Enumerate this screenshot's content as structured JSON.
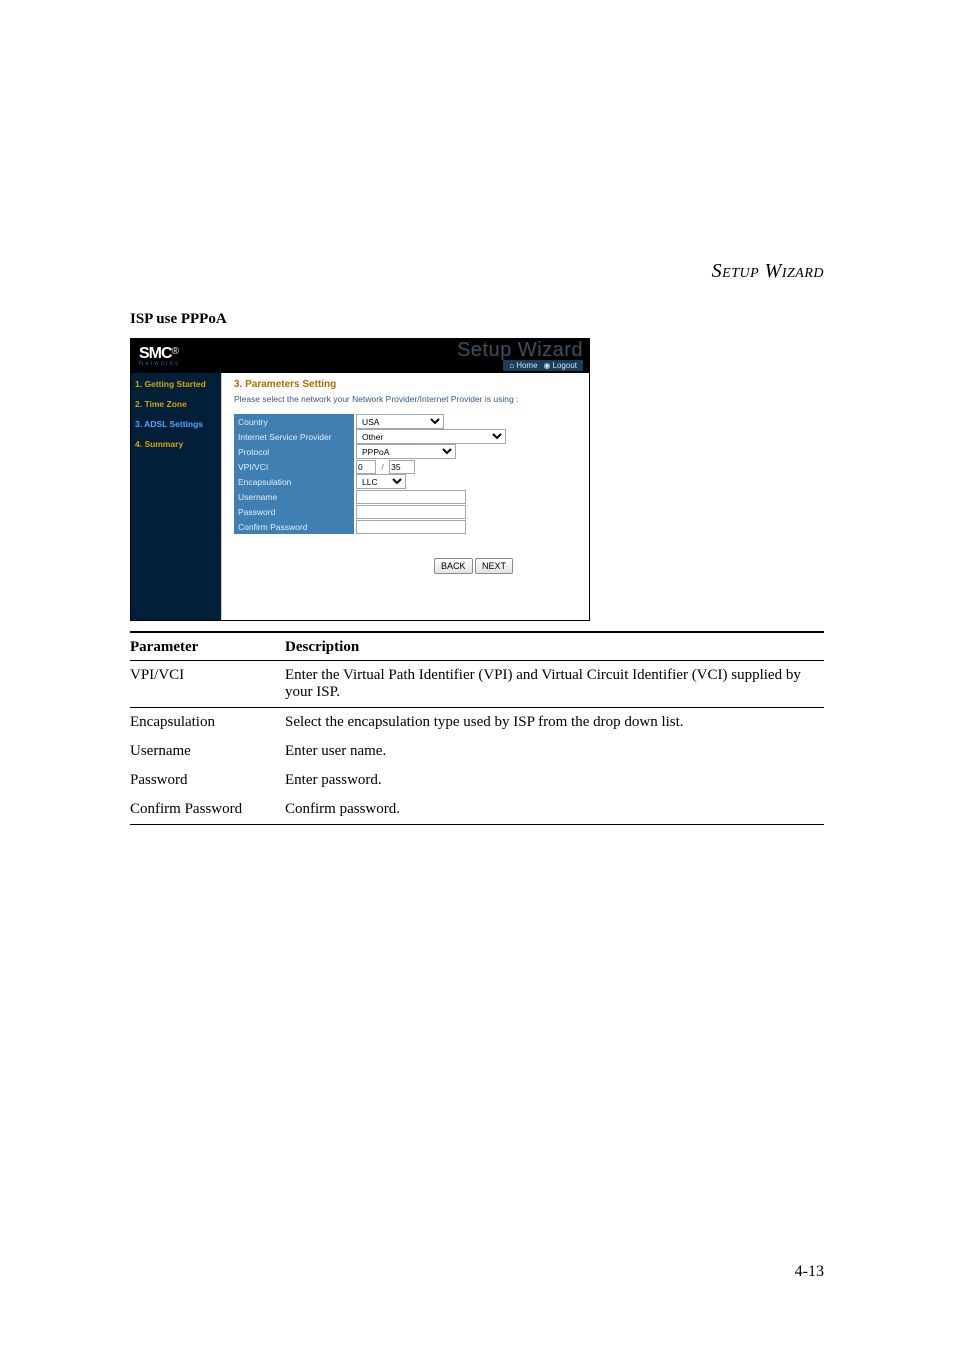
{
  "doc": {
    "running_head": "Setup Wizard",
    "section_title": "ISP use PPPoA",
    "page_number": "4-13"
  },
  "shot": {
    "brand": "SMC",
    "brand_sub": "Networks",
    "watermark": "Setup Wizard",
    "home_label": "Home",
    "logout_label": "Logout",
    "sidebar": {
      "s1": "1. Getting Started",
      "s2": "2. Time Zone",
      "s3": "3. ADSL Settings",
      "s4": "4. Summary"
    },
    "heading": "3. Parameters Setting",
    "instruction": "Please select the network your Network Provider/Internet Provider is using :",
    "rows": {
      "country": {
        "label": "Country",
        "value": "USA"
      },
      "isp": {
        "label": "Internet Service Provider",
        "value": "Other"
      },
      "protocol": {
        "label": "Protocol",
        "value": "PPPoA"
      },
      "vpivci": {
        "label": "VPI/VCI",
        "vpi": "0",
        "vci": "35"
      },
      "encap": {
        "label": "Encapsulation",
        "value": "LLC"
      },
      "user": {
        "label": "Username",
        "value": ""
      },
      "pass": {
        "label": "Password",
        "value": ""
      },
      "cpass": {
        "label": "Confirm Password",
        "value": ""
      }
    },
    "buttons": {
      "back": "BACK",
      "next": "NEXT"
    }
  },
  "table": {
    "h_param": "Parameter",
    "h_desc": "Description",
    "r1p": "VPI/VCI",
    "r1d": "Enter the Virtual Path Identifier (VPI) and Virtual Circuit Identifier (VCI) supplied by your ISP.",
    "r2p": "Encapsulation",
    "r2d": "Select the encapsulation type used by ISP from the drop down list.",
    "r3p": "Username",
    "r3d": "Enter user name.",
    "r4p": "Password",
    "r4d": "Enter password.",
    "r5p": "Confirm Password",
    "r5d": "Confirm password."
  }
}
